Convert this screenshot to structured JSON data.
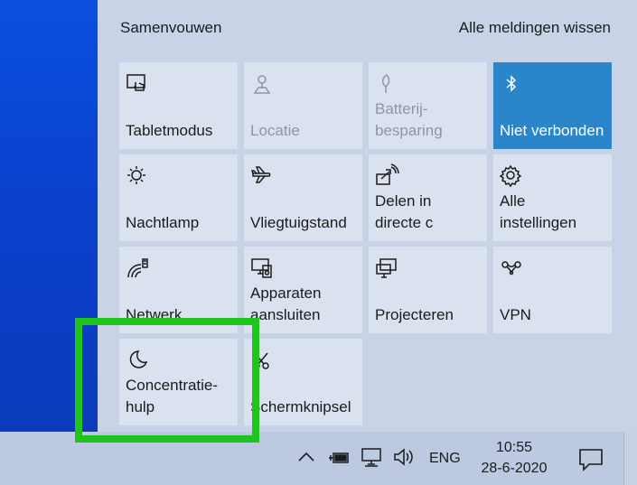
{
  "action_center": {
    "collapse_label": "Samenvouwen",
    "clear_label": "Alle meldingen wissen",
    "tiles": [
      {
        "label": "Tabletmodus",
        "icon": "tablet-mode-icon",
        "state": "normal"
      },
      {
        "label": "Locatie",
        "icon": "location-icon",
        "state": "disabled"
      },
      {
        "label": "Batterij-\nbesparing",
        "icon": "battery-saver-icon",
        "state": "disabled"
      },
      {
        "label": "Niet verbonden",
        "icon": "bluetooth-icon",
        "state": "active"
      },
      {
        "label": "Nachtlamp",
        "icon": "night-light-icon",
        "state": "normal"
      },
      {
        "label": "Vliegtuigstand",
        "icon": "airplane-icon",
        "state": "normal"
      },
      {
        "label": "Delen in\ndirecte c",
        "icon": "nearby-share-icon",
        "state": "normal"
      },
      {
        "label": "Alle\ninstellingen",
        "icon": "settings-gear-icon",
        "state": "normal"
      },
      {
        "label": "Netwerk",
        "icon": "network-icon",
        "state": "normal"
      },
      {
        "label": "Apparaten\naansluiten",
        "icon": "connect-devices-icon",
        "state": "normal"
      },
      {
        "label": "Projecteren",
        "icon": "project-icon",
        "state": "normal"
      },
      {
        "label": "VPN",
        "icon": "vpn-icon",
        "state": "normal"
      },
      {
        "label": "Concentratie-\nhulp",
        "icon": "moon-icon",
        "state": "normal"
      },
      {
        "label": "Schermknipsel",
        "icon": "snip-icon",
        "state": "normal"
      }
    ]
  },
  "taskbar": {
    "language": "ENG",
    "time": "10:55",
    "date": "28-6-2020",
    "tray_icons": [
      "chevron-up-icon",
      "battery-plug-icon",
      "network-wired-icon",
      "volume-icon"
    ]
  },
  "highlight": {
    "color": "#1fc41c",
    "target": "Concentratie-hulp"
  },
  "colors": {
    "accent": "#2a86c9",
    "tile": "#dbe2ef",
    "panel": "#c8d3e8"
  }
}
